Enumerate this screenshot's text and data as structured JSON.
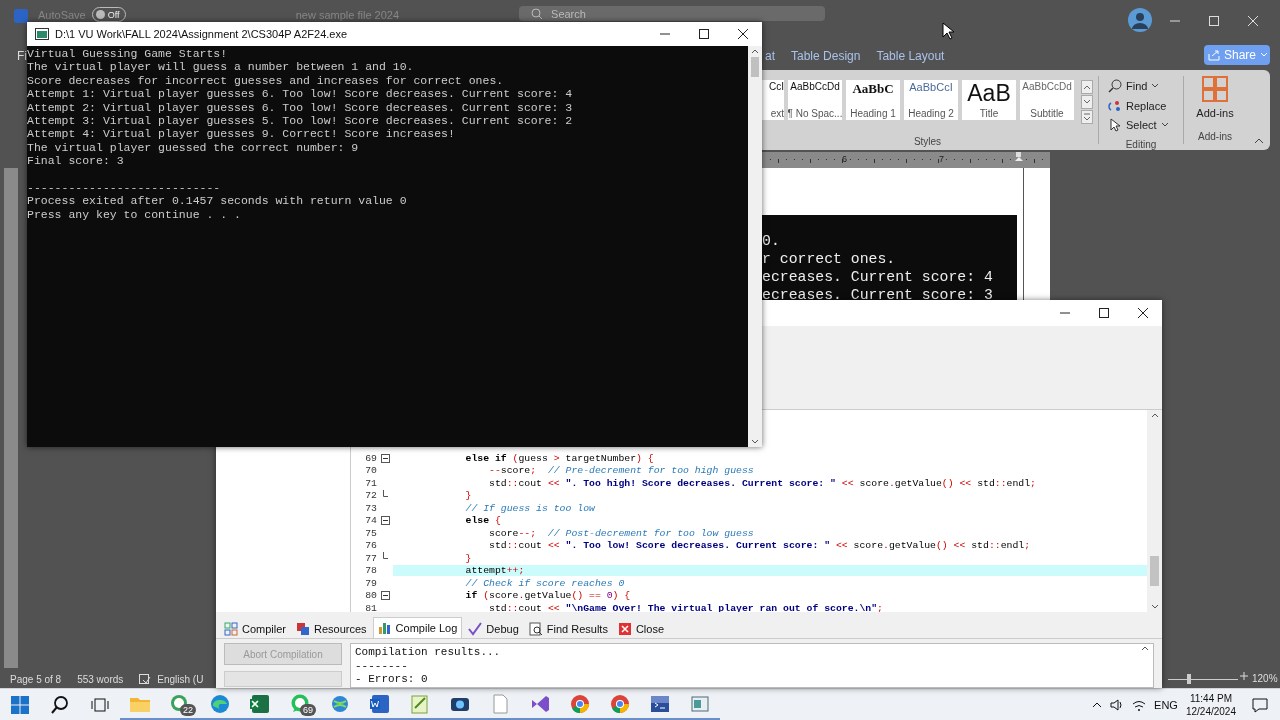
{
  "word": {
    "title_bar": {
      "autosave": "AutoSave",
      "autosave_toggle": {
        "label": "Off",
        "on": false
      },
      "document_name": "new sample file 2024",
      "search": {
        "placeholder": "Search"
      }
    },
    "file_tab_partial": "Fi",
    "ribbon_tabs": [
      {
        "label": "at",
        "selected": false
      },
      {
        "label": "Table Design",
        "selected": false
      },
      {
        "label": "Table Layout",
        "selected": false
      }
    ],
    "share_button": "Share",
    "styles": [
      {
        "sample": "CcI",
        "name": "ext",
        "kind": "normal"
      },
      {
        "sample": "AaBbCcDd",
        "name": "¶ No Spac...",
        "kind": "normal"
      },
      {
        "sample": "AaBbC",
        "name": "Heading 1",
        "kind": "heading1"
      },
      {
        "sample": "AaBbCcI",
        "name": "Heading 2",
        "kind": "heading2"
      },
      {
        "sample": "AaB",
        "name": "Title",
        "kind": "title"
      },
      {
        "sample": "AaBbCcDd",
        "name": "Subtitle",
        "kind": "subtitle"
      }
    ],
    "styles_group": "Styles",
    "editing": [
      {
        "label": "Find",
        "kind": "find",
        "dropdown": true
      },
      {
        "label": "Replace",
        "kind": "replace",
        "dropdown": false
      },
      {
        "label": "Select",
        "kind": "select",
        "dropdown": true
      }
    ],
    "editing_group": "Editing",
    "addins_button": "Add-ins",
    "addins_group": "Add-ins",
    "ruler_numbers": [
      "6",
      "7"
    ],
    "document_image_lines": [
      "0.",
      "r correct ones.",
      "ecreases. Current score: 4",
      "ecreases. Current score: 3"
    ],
    "status_bar": {
      "page": "Page 5 of 8",
      "words": "553 words",
      "language": "English (U",
      "zoom": "120%",
      "zoom_slider": {
        "level": 0.3
      }
    }
  },
  "console": {
    "title": "D:\\1 VU Work\\FALL 2024\\Assignment 2\\CS304P A2F24.exe",
    "blocks": [
      [
        "Virtual Guessing Game Starts!",
        "The virtual player will guess a number between 1 and 10.",
        "Score decreases for incorrect guesses and increases for correct ones.",
        "Attempt 1: Virtual player guesses 6. Too low! Score decreases. Current score: 4",
        "Attempt 2: Virtual player guesses 6. Too low! Score decreases. Current score: 3",
        "Attempt 3: Virtual player guesses 5. Too low! Score decreases. Current score: 2",
        "Attempt 4: Virtual player guesses 9. Correct! Score increases!",
        "The virtual player guessed the correct number: 9",
        "Final score: 3"
      ],
      [
        "----------------------------",
        "Process exited after 0.1457 seconds with return value 0",
        "Press any key to continue . . ."
      ]
    ]
  },
  "devcpp": {
    "code_lines": [
      {
        "number": "69",
        "fold_start": true,
        "fold_end": false,
        "highlighted": false,
        "segments": [
          {
            "kind": "kw",
            "text": "            else if"
          },
          {
            "kind": "op",
            "text": " ("
          },
          {
            "kind": "id",
            "text": "guess "
          },
          {
            "kind": "op",
            "text": ">"
          },
          {
            "kind": "id",
            "text": " targetNumber"
          },
          {
            "kind": "op",
            "text": ") {"
          }
        ]
      },
      {
        "number": "70",
        "fold_start": false,
        "fold_end": false,
        "highlighted": false,
        "segments": [
          {
            "kind": "op",
            "text": "                --"
          },
          {
            "kind": "id",
            "text": "score"
          },
          {
            "kind": "op",
            "text": ";"
          },
          {
            "kind": "cmt",
            "text": "  // Pre-decrement for too high guess"
          }
        ]
      },
      {
        "number": "71",
        "fold_start": false,
        "fold_end": false,
        "highlighted": false,
        "segments": [
          {
            "kind": "id",
            "text": "                std"
          },
          {
            "kind": "op",
            "text": "::"
          },
          {
            "kind": "id",
            "text": "cout "
          },
          {
            "kind": "op",
            "text": "<< "
          },
          {
            "kind": "str",
            "text": "\". Too high! Score decreases. Current score: \""
          },
          {
            "kind": "op",
            "text": " << "
          },
          {
            "kind": "id",
            "text": "score"
          },
          {
            "kind": "op",
            "text": "."
          },
          {
            "kind": "id",
            "text": "getValue"
          },
          {
            "kind": "op",
            "text": "() << "
          },
          {
            "kind": "id",
            "text": "std"
          },
          {
            "kind": "op",
            "text": "::"
          },
          {
            "kind": "id",
            "text": "endl"
          },
          {
            "kind": "op",
            "text": ";"
          }
        ]
      },
      {
        "number": "72",
        "fold_start": false,
        "fold_end": true,
        "highlighted": false,
        "segments": [
          {
            "kind": "op",
            "text": "            }"
          }
        ]
      },
      {
        "number": "73",
        "fold_start": false,
        "fold_end": false,
        "highlighted": false,
        "segments": [
          {
            "kind": "cmt",
            "text": "            // If guess is too low"
          }
        ]
      },
      {
        "number": "74",
        "fold_start": true,
        "fold_end": false,
        "highlighted": false,
        "segments": [
          {
            "kind": "kw",
            "text": "            else"
          },
          {
            "kind": "op",
            "text": " {"
          }
        ]
      },
      {
        "number": "75",
        "fold_start": false,
        "fold_end": false,
        "highlighted": false,
        "segments": [
          {
            "kind": "id",
            "text": "                score"
          },
          {
            "kind": "op",
            "text": "--;"
          },
          {
            "kind": "cmt",
            "text": "  // Post-decrement for too low guess"
          }
        ]
      },
      {
        "number": "76",
        "fold_start": false,
        "fold_end": false,
        "highlighted": false,
        "segments": [
          {
            "kind": "id",
            "text": "                std"
          },
          {
            "kind": "op",
            "text": "::"
          },
          {
            "kind": "id",
            "text": "cout "
          },
          {
            "kind": "op",
            "text": "<< "
          },
          {
            "kind": "str",
            "text": "\". Too low! Score decreases. Current score: \""
          },
          {
            "kind": "op",
            "text": " << "
          },
          {
            "kind": "id",
            "text": "score"
          },
          {
            "kind": "op",
            "text": "."
          },
          {
            "kind": "id",
            "text": "getValue"
          },
          {
            "kind": "op",
            "text": "() << "
          },
          {
            "kind": "id",
            "text": "std"
          },
          {
            "kind": "op",
            "text": "::"
          },
          {
            "kind": "id",
            "text": "endl"
          },
          {
            "kind": "op",
            "text": ";"
          }
        ]
      },
      {
        "number": "77",
        "fold_start": false,
        "fold_end": true,
        "highlighted": false,
        "segments": [
          {
            "kind": "op",
            "text": "            }"
          }
        ]
      },
      {
        "number": "78",
        "fold_start": false,
        "fold_end": false,
        "highlighted": true,
        "segments": [
          {
            "kind": "id",
            "text": "            attempt"
          },
          {
            "kind": "op",
            "text": "++;"
          }
        ]
      },
      {
        "number": "79",
        "fold_start": false,
        "fold_end": false,
        "highlighted": false,
        "segments": [
          {
            "kind": "cmt",
            "text": "            // Check if score reaches 0"
          }
        ]
      },
      {
        "number": "80",
        "fold_start": true,
        "fold_end": false,
        "highlighted": false,
        "segments": [
          {
            "kind": "kw",
            "text": "            if"
          },
          {
            "kind": "op",
            "text": " ("
          },
          {
            "kind": "id",
            "text": "score"
          },
          {
            "kind": "op",
            "text": "."
          },
          {
            "kind": "id",
            "text": "getValue"
          },
          {
            "kind": "op",
            "text": "() == "
          },
          {
            "kind": "num",
            "text": "0"
          },
          {
            "kind": "op",
            "text": ") {"
          }
        ]
      },
      {
        "number": "81",
        "fold_start": false,
        "fold_end": false,
        "highlighted": false,
        "segments": [
          {
            "kind": "id",
            "text": "                std"
          },
          {
            "kind": "op",
            "text": "::"
          },
          {
            "kind": "id",
            "text": "cout "
          },
          {
            "kind": "op",
            "text": "<< "
          },
          {
            "kind": "str",
            "text": "\"\\nGame Over! The virtual player ran out of score.\\n\""
          },
          {
            "kind": "op",
            "text": ";"
          }
        ]
      }
    ],
    "bottom_tabs": [
      {
        "label": "Compiler",
        "kind": "compiler",
        "selected": false
      },
      {
        "label": "Resources",
        "kind": "resources",
        "selected": false
      },
      {
        "label": "Compile Log",
        "kind": "log",
        "selected": true
      },
      {
        "label": "Debug",
        "kind": "debug",
        "selected": false
      },
      {
        "label": "Find Results",
        "kind": "find",
        "selected": false
      },
      {
        "label": "Close",
        "kind": "close",
        "selected": false
      }
    ],
    "abort_button": {
      "label": "Abort Compilation",
      "disabled": true
    },
    "log_lines": [
      "Compilation results...",
      "--------",
      "- Errors: 0"
    ]
  },
  "taskbar": {
    "apps": [
      {
        "kind": "folder",
        "running": true
      },
      {
        "kind": "chat",
        "running": true,
        "badge": "22"
      },
      {
        "kind": "edge",
        "running": true
      },
      {
        "kind": "excel",
        "running": true
      },
      {
        "kind": "whatsapp",
        "running": true,
        "badge": "69"
      },
      {
        "kind": "globe",
        "running": true
      },
      {
        "kind": "word",
        "running": true
      },
      {
        "kind": "notepad",
        "running": true
      },
      {
        "kind": "camera",
        "running": true
      },
      {
        "kind": "page",
        "running": true
      },
      {
        "kind": "loop",
        "running": true
      },
      {
        "kind": "chrome",
        "running": true
      },
      {
        "kind": "chrome",
        "running": true
      },
      {
        "kind": "dev",
        "running": true
      },
      {
        "kind": "window",
        "running": true
      }
    ],
    "tray": {
      "language": "ENG",
      "time": "11:44 PM",
      "date": "12/24/2024"
    }
  }
}
